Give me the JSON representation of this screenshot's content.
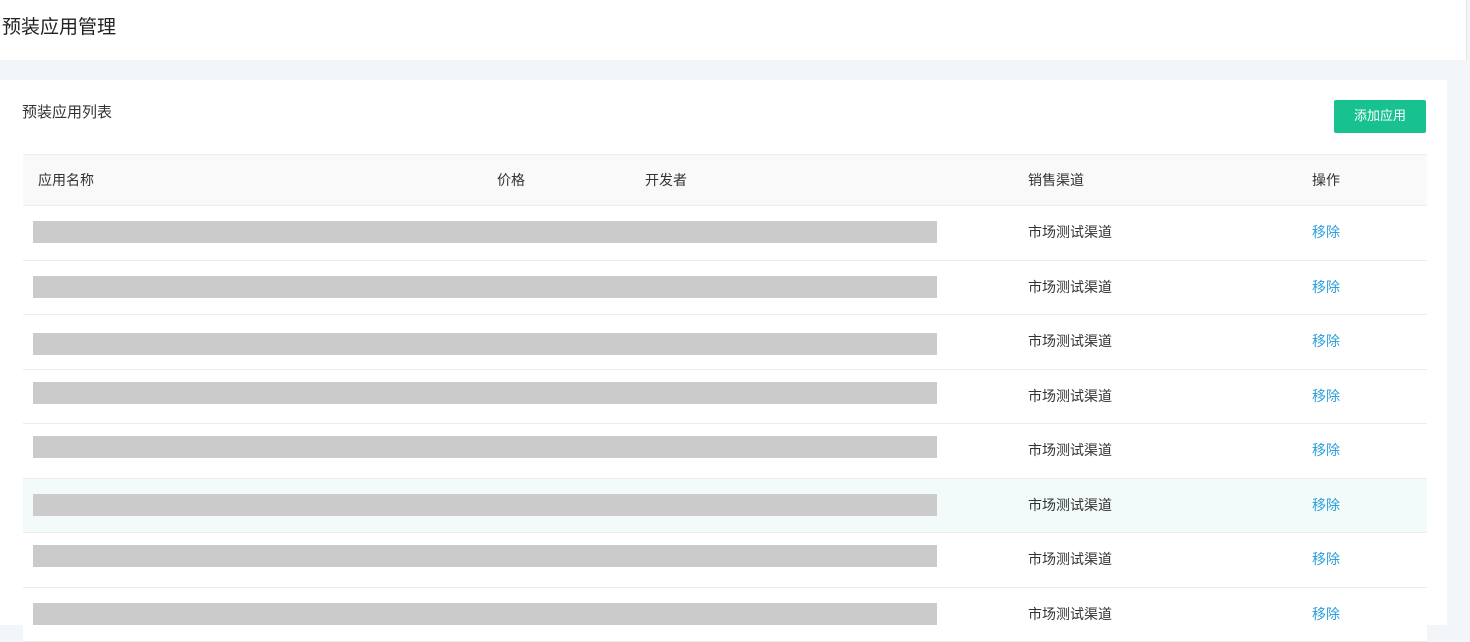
{
  "header": {
    "title": "预装应用管理"
  },
  "card": {
    "title": "预装应用列表",
    "add_button_label": "添加应用",
    "accent_color": "#18c290",
    "link_color": "#2c9fd9"
  },
  "table": {
    "columns": [
      "应用名称",
      "价格",
      "开发者",
      "销售渠道",
      "操作"
    ],
    "rows": [
      {
        "channel": "市场测试渠道",
        "action": "移除",
        "redacted": true
      },
      {
        "channel": "市场测试渠道",
        "action": "移除",
        "redacted": true
      },
      {
        "channel": "市场测试渠道",
        "action": "移除",
        "redacted": true
      },
      {
        "channel": "市场测试渠道",
        "action": "移除",
        "redacted": true
      },
      {
        "channel": "市场测试渠道",
        "action": "移除",
        "redacted": true
      },
      {
        "channel": "市场测试渠道",
        "action": "移除",
        "redacted": true,
        "hovered": true
      },
      {
        "channel": "市场测试渠道",
        "action": "移除",
        "redacted": true
      },
      {
        "channel": "市场测试渠道",
        "action": "移除",
        "redacted": true
      }
    ]
  }
}
